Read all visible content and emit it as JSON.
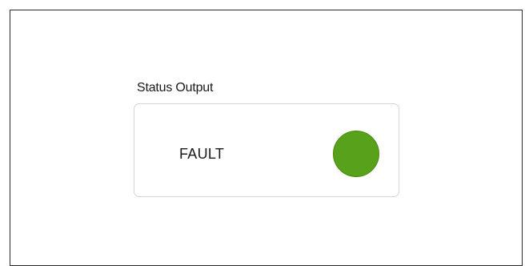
{
  "status_group": {
    "label": "Status Output",
    "status_text": "FAULT",
    "indicator": {
      "icon": "status-led-icon",
      "color": "#58a11b",
      "state": "on"
    }
  }
}
